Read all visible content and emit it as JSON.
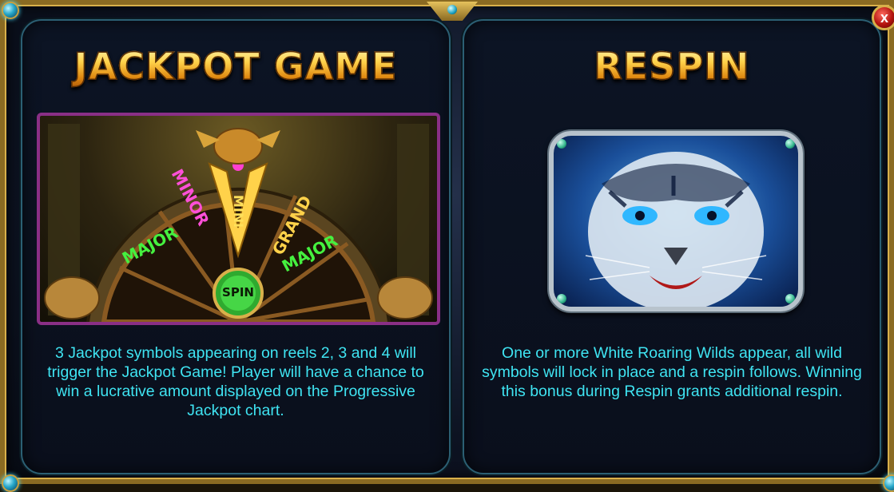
{
  "window": {
    "close_label": "x"
  },
  "panels": {
    "jackpot": {
      "title": "JACKPOT GAME",
      "wheel_labels": [
        "MAJOR",
        "MINOR",
        "MINI",
        "GRAND",
        "MAJOR"
      ],
      "spin_label": "SPIN",
      "description": "3 Jackpot symbols appearing on reels 2, 3 and 4 will trigger the Jackpot Game! Player will have a chance to win a lucrative amount displayed on the Progressive Jackpot chart."
    },
    "respin": {
      "title": "RESPIN",
      "description": "One or more White Roaring Wilds appear, all wild symbols will lock in place and a respin follows. Winning this bonus during Respin grants additional respin."
    }
  },
  "colors": {
    "title_gold": "#ffd24a",
    "body_text": "#3fe4f2",
    "frame_gold": "#d9b04a",
    "close_red": "#b3140e"
  },
  "icons": {
    "close": "close-icon",
    "corner_gems": "gem-icon"
  }
}
